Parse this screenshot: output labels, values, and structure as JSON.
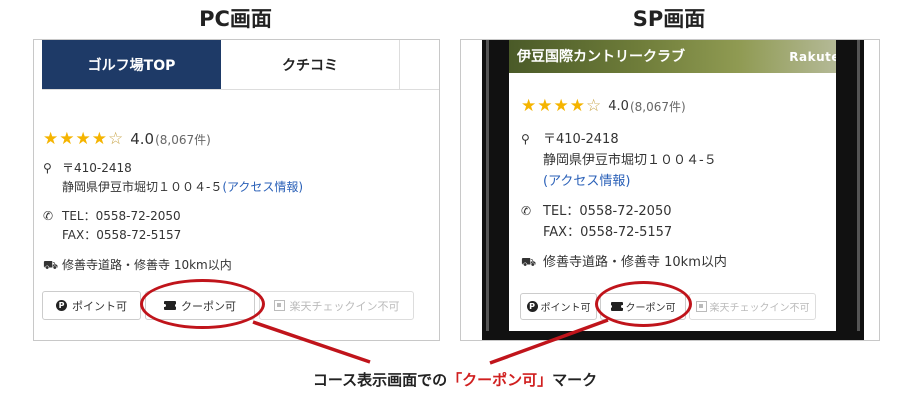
{
  "headings": {
    "pc": "PC画面",
    "sp": "SP画面"
  },
  "pc": {
    "tabs": [
      "ゴルフ場TOP",
      "クチコミ"
    ],
    "rating": {
      "score": "4.0",
      "count": "(8,067件)"
    },
    "postal": "〒410-2418",
    "address": "静岡県伊豆市堀切１００４-５",
    "access_link": "(アクセス情報)",
    "tel": "TEL：0558-72-2050",
    "fax": "FAX：0558-72-5157",
    "route": "修善寺道路・修善寺 10km以内",
    "badges": [
      "ポイント可",
      "クーポン可",
      "楽天チェックイン不可"
    ]
  },
  "sp": {
    "banner_title": "伊豆国際カントリークラブ",
    "banner_logo": "Rakute",
    "rating": {
      "score": "4.0",
      "count": "(8,067件)"
    },
    "postal": "〒410-2418",
    "address": "静岡県伊豆市堀切１００４-５",
    "access_link": "(アクセス情報)",
    "tel": "TEL：0558-72-2050",
    "fax": "FAX：0558-72-5157",
    "route": "修善寺道路・修善寺 10km以内",
    "badges": [
      "ポイント可",
      "クーポン可",
      "楽天チェックイン不可"
    ]
  },
  "caption": {
    "before": "コース表示画面での",
    "highlight": "「クーポン可」",
    "after": "マーク"
  },
  "colors": {
    "tab_active": "#1e3a67",
    "link": "#2b61b8",
    "star": "#f5b400",
    "highlight": "#c0141b"
  }
}
